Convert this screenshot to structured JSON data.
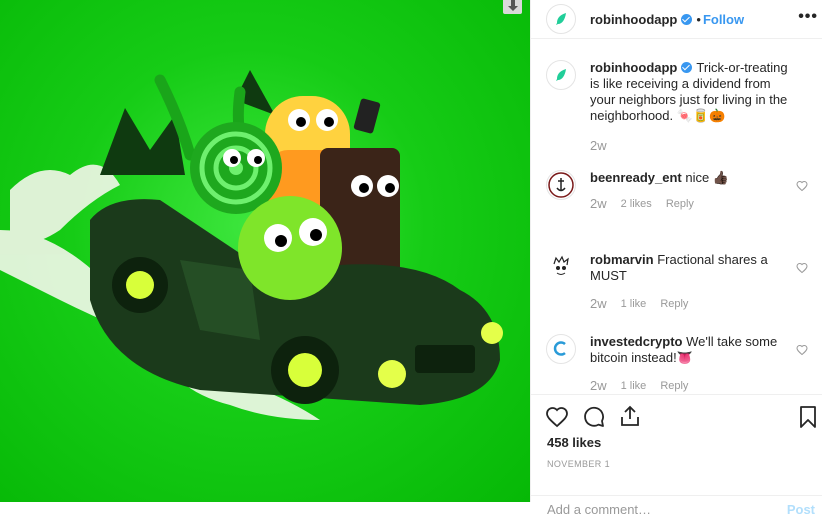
{
  "header": {
    "username": "robinhoodapp",
    "separator": "•",
    "follow": "Follow",
    "more_icon": "more-horizontal-icon"
  },
  "caption": {
    "username": "robinhoodapp",
    "text": "Trick-or-treating is like receiving a dividend from your neighbors just for living in the neighborhood. 🍬🥫🎃",
    "age": "2w"
  },
  "comments": [
    {
      "username": "beenready_ent",
      "text": "nice 👍🏿",
      "age": "2w",
      "likes": "2 likes",
      "reply": "Reply"
    },
    {
      "username": "robmarvin",
      "text": "Fractional shares a MUST",
      "age": "2w",
      "likes": "1 like",
      "reply": "Reply"
    },
    {
      "username": "investedcrypto",
      "text": "We'll take some bitcoin instead!👅",
      "age": "2w",
      "likes": "1 like",
      "reply": "Reply"
    }
  ],
  "post": {
    "likes": "458 likes",
    "date": "NOVEMBER 1"
  },
  "add_comment": {
    "placeholder": "Add a comment…",
    "post_label": "Post"
  },
  "colors": {
    "accent": "#3897f0",
    "brand_green": "#21ce99",
    "image_bg": "#00c805"
  }
}
